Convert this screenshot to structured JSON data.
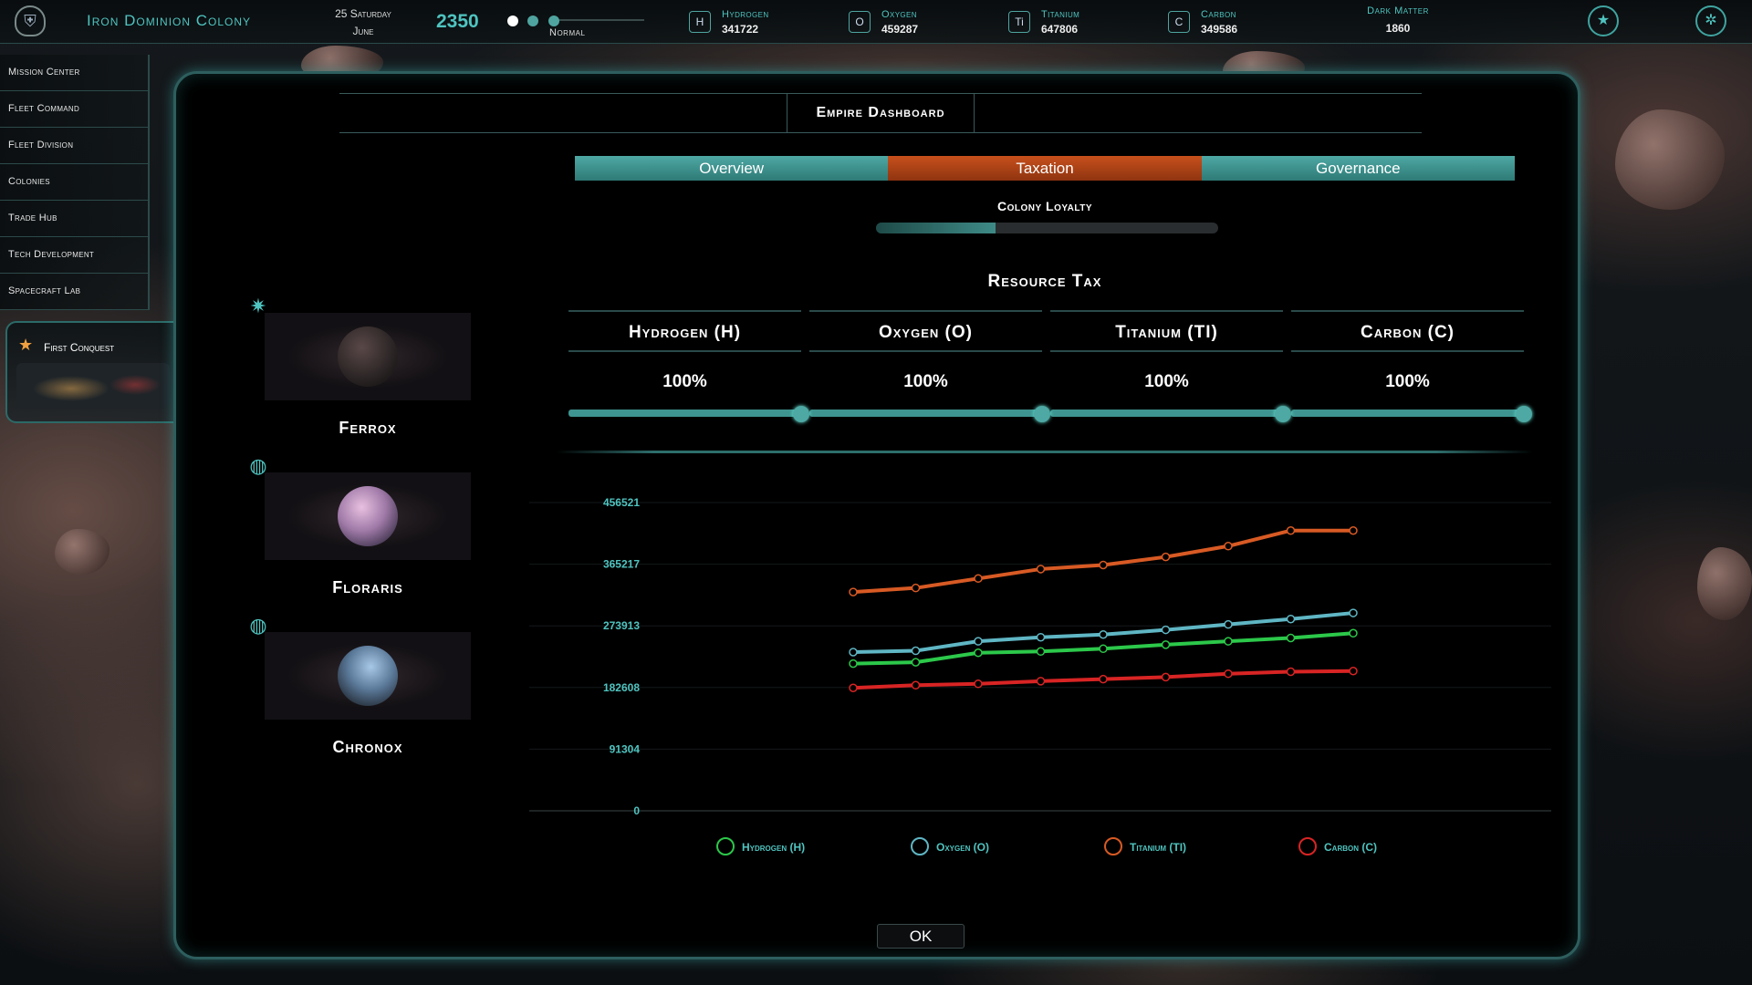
{
  "topbar": {
    "colony_name": "Iron Dominion Colony",
    "date_line1": "25 Saturday",
    "date_line2": "June",
    "year": "2350",
    "speed_label": "Normal",
    "resources": [
      {
        "letter": "H",
        "name": "Hydrogen",
        "value": "341722"
      },
      {
        "letter": "O",
        "name": "Oxygen",
        "value": "459287"
      },
      {
        "letter": "Ti",
        "name": "Titanium",
        "value": "647806"
      },
      {
        "letter": "C",
        "name": "Carbon",
        "value": "349586"
      }
    ],
    "dark_matter": {
      "name": "Dark Matter",
      "value": "1860"
    },
    "icons": [
      "shield-emblem-icon",
      "star-badge-icon",
      "settings-icon"
    ]
  },
  "nav": {
    "items": [
      {
        "label": "Mission Center"
      },
      {
        "label": "Fleet Command"
      },
      {
        "label": "Fleet Division"
      },
      {
        "label": "Colonies"
      },
      {
        "label": "Trade Hub"
      },
      {
        "label": "Tech Development"
      },
      {
        "label": "Spacecraft Lab"
      }
    ],
    "conquest": {
      "label": "First Conquest",
      "icon": "star-icon"
    }
  },
  "dialog": {
    "title": "Empire Dashboard",
    "tabs": [
      {
        "label": "Overview",
        "active": false
      },
      {
        "label": "Taxation",
        "active": true
      },
      {
        "label": "Governance",
        "active": false
      }
    ],
    "loyalty": {
      "label": "Colony Loyalty",
      "level": 0.35
    },
    "tax_title": "Resource Tax",
    "taxes": [
      {
        "name": "Hydrogen (H)",
        "value": "100%",
        "level": 1.0
      },
      {
        "name": "Oxygen (O)",
        "value": "100%",
        "level": 1.0
      },
      {
        "name": "Titanium (TI)",
        "value": "100%",
        "level": 1.0
      },
      {
        "name": "Carbon (C)",
        "value": "100%",
        "level": 1.0
      }
    ],
    "planets": [
      {
        "name": "Ferrox",
        "badge": "star-cluster-icon",
        "color": "#3a3434"
      },
      {
        "name": "Floraris",
        "badge": "globe-icon",
        "color": "#b08ab0"
      },
      {
        "name": "Chronox",
        "badge": "globe-icon",
        "color": "#5a7898"
      }
    ],
    "ok_label": "OK"
  },
  "chart_data": {
    "type": "line",
    "x": [
      1,
      2,
      3,
      4,
      5,
      6,
      7,
      8,
      9
    ],
    "yticks": [
      "456521",
      "365217",
      "273913",
      "182608",
      "91304",
      "0"
    ],
    "ylim": [
      0,
      456521
    ],
    "grid": true,
    "legend_position": "bottom",
    "series": [
      {
        "name": "Hydrogen (H)",
        "color": "#2cc84a",
        "values": [
          218000,
          220000,
          234000,
          236000,
          240000,
          246000,
          251000,
          256000,
          263000
        ]
      },
      {
        "name": "Oxygen (O)",
        "color": "#5fb6c4",
        "values": [
          235000,
          237000,
          251000,
          257000,
          261000,
          268000,
          276000,
          284000,
          293000
        ]
      },
      {
        "name": "Titanium (TI)",
        "color": "#d85a24",
        "values": [
          324000,
          330000,
          344000,
          358000,
          364000,
          376000,
          392000,
          415000,
          415000
        ]
      },
      {
        "name": "Carbon (C)",
        "color": "#d82424",
        "values": [
          182000,
          186000,
          188000,
          192000,
          195000,
          198000,
          203000,
          206000,
          207000
        ]
      }
    ]
  }
}
